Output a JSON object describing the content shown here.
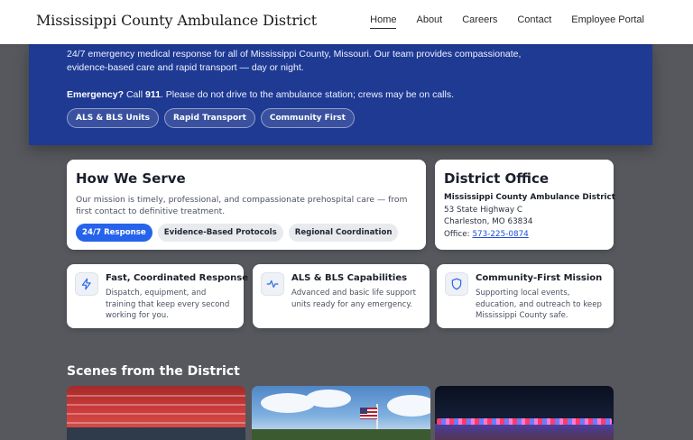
{
  "header": {
    "brand": "Mississippi County Ambulance District",
    "nav": [
      {
        "label": "Home",
        "active": true
      },
      {
        "label": "About"
      },
      {
        "label": "Careers"
      },
      {
        "label": "Contact"
      },
      {
        "label": "Employee Portal"
      }
    ]
  },
  "hero": {
    "description": "24/7 emergency medical response for all of Mississippi County, Missouri. Our team provides compassionate, evidence-based care and rapid transport — day or night.",
    "emergency_label": "Emergency?",
    "emergency_call": "Call",
    "emergency_number": "911",
    "emergency_note": ". Please do not drive to the ambulance station; crews may be on calls.",
    "chips": [
      "ALS & BLS Units",
      "Rapid Transport",
      "Community First"
    ]
  },
  "serve": {
    "title": "How We Serve",
    "text": "Our mission is timely, professional, and compassionate prehospital care — from first contact to definitive treatment.",
    "chips": [
      "24/7 Response",
      "Evidence-Based Protocols",
      "Regional Coordination"
    ]
  },
  "office": {
    "title": "District Office",
    "name": "Mississippi County Ambulance District",
    "address1": "53 State Highway C",
    "address2": "Charleston, MO 63834",
    "phone_label": "Office:",
    "phone": "573-225-0874"
  },
  "features": [
    {
      "icon": "lightning-icon",
      "title": "Fast, Coordinated Response",
      "desc": "Dispatch, equipment, and training that keep every second working for you."
    },
    {
      "icon": "pulse-icon",
      "title": "ALS & BLS Capabilities",
      "desc": "Advanced and basic life support units ready for any emergency."
    },
    {
      "icon": "shield-icon",
      "title": "Community-First Mission",
      "desc": "Supporting local events, education, and outreach to keep Mississippi County safe."
    }
  ],
  "scenes": {
    "title": "Scenes from the District"
  },
  "colors": {
    "hero_bg": "#1f3a93",
    "accent": "#2563eb",
    "page_bg": "#56585d",
    "link": "#1d4ed8"
  }
}
